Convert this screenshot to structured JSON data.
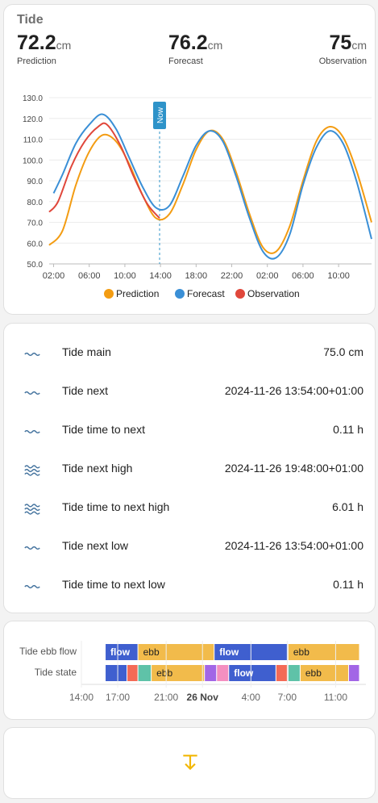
{
  "card_title": "Tide",
  "stats": {
    "prediction": {
      "value": "72.2",
      "unit": "cm",
      "label": "Prediction"
    },
    "forecast": {
      "value": "76.2",
      "unit": "cm",
      "label": "Forecast"
    },
    "observation": {
      "value": "75",
      "unit": "cm",
      "label": "Observation"
    }
  },
  "chart_data": {
    "type": "line",
    "now_label": "Now",
    "x_ticks": [
      "02:00",
      "06:00",
      "10:00",
      "14:00",
      "18:00",
      "22:00",
      "02:00",
      "06:00",
      "10:00"
    ],
    "y_ticks": [
      "130.0",
      "120.0",
      "110.0",
      "100.0",
      "90.0",
      "80.0",
      "70.0",
      "60.0",
      "50.0"
    ],
    "ylim": [
      50,
      130
    ],
    "x_range_hours": [
      1.5,
      37.7
    ],
    "now_hour": 13.9,
    "series": [
      {
        "name": "Prediction",
        "color": "#f39c12",
        "x": [
          1.5,
          3,
          4.5,
          6,
          7.5,
          9,
          10.5,
          12,
          13.5,
          15,
          16.5,
          18,
          19.5,
          21,
          22.5,
          24,
          25.5,
          27,
          28.5,
          30,
          31.5,
          33,
          34.5,
          36,
          37.7
        ],
        "y": [
          59,
          66,
          88,
          104,
          112,
          109,
          98,
          83,
          72,
          74,
          88,
          105,
          114,
          110,
          94,
          74,
          58,
          56,
          68,
          90,
          109,
          116,
          111,
          95,
          70
        ]
      },
      {
        "name": "Forecast",
        "color": "#3a8fd6",
        "x": [
          2,
          3,
          4.5,
          6,
          7.5,
          9,
          10.5,
          12,
          13.5,
          15,
          16.5,
          18,
          19.5,
          21,
          22.5,
          24,
          25.5,
          27,
          28.5,
          30,
          31.5,
          33,
          34.5,
          36,
          37.7
        ],
        "y": [
          84,
          93,
          108,
          117,
          122,
          115,
          101,
          87,
          77,
          78,
          92,
          107,
          114,
          109,
          92,
          72,
          56,
          53,
          64,
          88,
          106,
          114,
          108,
          90,
          62
        ]
      },
      {
        "name": "Observation",
        "color": "#e0473b",
        "x": [
          1.5,
          2.5,
          4,
          5.5,
          7,
          8,
          9.5,
          11,
          12.5,
          13.9
        ],
        "y": [
          75,
          80,
          97,
          109,
          116,
          117,
          107,
          92,
          79,
          72
        ]
      }
    ]
  },
  "sensors": [
    {
      "icon": "waves-icon",
      "name": "Tide main",
      "value": "75.0 cm"
    },
    {
      "icon": "waves-icon",
      "name": "Tide next",
      "value": "2024-11-26 13:54:00+01:00"
    },
    {
      "icon": "waves-icon",
      "name": "Tide time to next",
      "value": "0.11 h"
    },
    {
      "icon": "waves-high-icon",
      "name": "Tide next high",
      "value": "2024-11-26 19:48:00+01:00"
    },
    {
      "icon": "waves-high-icon",
      "name": "Tide time to next high",
      "value": "6.01 h"
    },
    {
      "icon": "waves-icon",
      "name": "Tide next low",
      "value": "2024-11-26 13:54:00+01:00"
    },
    {
      "icon": "waves-icon",
      "name": "Tide time to next low",
      "value": "0.11 h"
    }
  ],
  "timeline": {
    "rows": [
      {
        "label": "Tide ebb flow",
        "segments": [
          {
            "start": 16.0,
            "end": 18.7,
            "text": "flow",
            "color": "#3f5fcf"
          },
          {
            "start": 18.7,
            "end": 25.0,
            "text": "ebb",
            "color": "#f2bb4b"
          },
          {
            "start": 25.0,
            "end": 31.1,
            "text": "flow",
            "color": "#3f5fcf"
          },
          {
            "start": 31.1,
            "end": 37.0,
            "text": "ebb",
            "color": "#f2bb4b"
          }
        ]
      },
      {
        "label": "Tide state",
        "segments": [
          {
            "start": 16.0,
            "end": 17.8,
            "text": "",
            "color": "#3f5fcf"
          },
          {
            "start": 17.8,
            "end": 18.7,
            "text": "",
            "color": "#f46a56"
          },
          {
            "start": 18.7,
            "end": 19.8,
            "text": "",
            "color": "#5fc2a8"
          },
          {
            "start": 19.8,
            "end": 24.2,
            "text": "ebb",
            "color": "#f2bb4b"
          },
          {
            "start": 24.2,
            "end": 25.2,
            "text": "",
            "color": "#a266e6"
          },
          {
            "start": 25.2,
            "end": 26.2,
            "text": "",
            "color": "#f48fc0"
          },
          {
            "start": 26.2,
            "end": 30.1,
            "text": "flow",
            "color": "#3f5fcf"
          },
          {
            "start": 30.1,
            "end": 31.1,
            "text": "",
            "color": "#f46a56"
          },
          {
            "start": 31.1,
            "end": 32.1,
            "text": "",
            "color": "#5fc2a8"
          },
          {
            "start": 32.1,
            "end": 36.1,
            "text": "ebb",
            "color": "#f2bb4b"
          },
          {
            "start": 36.1,
            "end": 37.0,
            "text": "",
            "color": "#a266e6"
          }
        ]
      }
    ],
    "ticks": [
      {
        "hour": 14,
        "text": "14:00",
        "bold": false
      },
      {
        "hour": 17,
        "text": "17:00",
        "bold": false
      },
      {
        "hour": 21,
        "text": "21:00",
        "bold": false
      },
      {
        "hour": 24,
        "text": "26 Nov",
        "bold": true
      },
      {
        "hour": 28,
        "text": "4:00",
        "bold": false
      },
      {
        "hour": 31,
        "text": "7:00",
        "bold": false
      },
      {
        "hour": 35,
        "text": "11:00",
        "bold": false
      }
    ],
    "range": [
      14,
      37.5
    ]
  },
  "footer": {
    "icon": "arrow-collapse-down-icon",
    "color": "#f2b705"
  }
}
